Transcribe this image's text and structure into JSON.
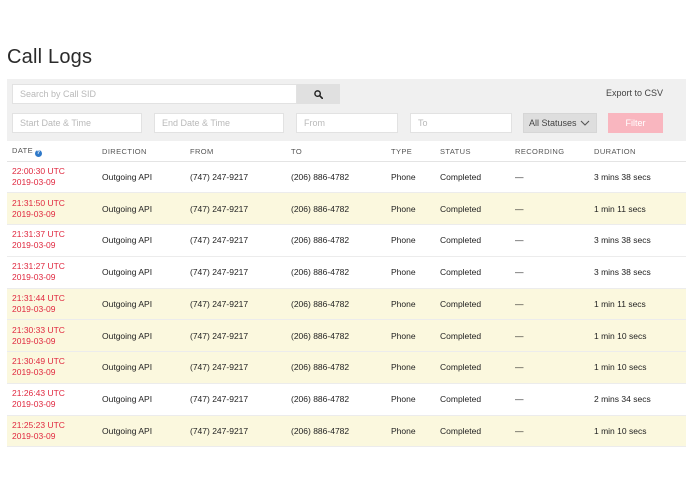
{
  "page": {
    "title": "Call Logs"
  },
  "search": {
    "placeholder": "Search by Call SID",
    "value": ""
  },
  "toolbar": {
    "export_label": "Export to CSV"
  },
  "filters": {
    "start_date_placeholder": "Start Date & Time",
    "end_date_placeholder": "End Date & Time",
    "from_placeholder": "From",
    "to_placeholder": "To",
    "status_selected": "All Statuses",
    "filter_label": "Filter"
  },
  "table": {
    "columns": {
      "date": "DATE",
      "direction": "DIRECTION",
      "from": "FROM",
      "to": "TO",
      "type": "TYPE",
      "status": "STATUS",
      "recording": "RECORDING",
      "duration": "DURATION"
    },
    "rows": [
      {
        "time": "22:00:30 UTC",
        "date": "2019-03-09",
        "direction": "Outgoing API",
        "from": "(747) 247-9217",
        "to": "(206) 886-4782",
        "type": "Phone",
        "status": "Completed",
        "recording": "—",
        "duration": "3 mins 38 secs",
        "highlighted": false
      },
      {
        "time": "21:31:50 UTC",
        "date": "2019-03-09",
        "direction": "Outgoing API",
        "from": "(747) 247-9217",
        "to": "(206) 886-4782",
        "type": "Phone",
        "status": "Completed",
        "recording": "—",
        "duration": "1 min 11 secs",
        "highlighted": true
      },
      {
        "time": "21:31:37 UTC",
        "date": "2019-03-09",
        "direction": "Outgoing API",
        "from": "(747) 247-9217",
        "to": "(206) 886-4782",
        "type": "Phone",
        "status": "Completed",
        "recording": "—",
        "duration": "3 mins 38 secs",
        "highlighted": false
      },
      {
        "time": "21:31:27 UTC",
        "date": "2019-03-09",
        "direction": "Outgoing API",
        "from": "(747) 247-9217",
        "to": "(206) 886-4782",
        "type": "Phone",
        "status": "Completed",
        "recording": "—",
        "duration": "3 mins 38 secs",
        "highlighted": false
      },
      {
        "time": "21:31:44 UTC",
        "date": "2019-03-09",
        "direction": "Outgoing API",
        "from": "(747) 247-9217",
        "to": "(206) 886-4782",
        "type": "Phone",
        "status": "Completed",
        "recording": "—",
        "duration": "1 min 11 secs",
        "highlighted": true
      },
      {
        "time": "21:30:33 UTC",
        "date": "2019-03-09",
        "direction": "Outgoing API",
        "from": "(747) 247-9217",
        "to": "(206) 886-4782",
        "type": "Phone",
        "status": "Completed",
        "recording": "—",
        "duration": "1 min 10 secs",
        "highlighted": true
      },
      {
        "time": "21:30:49 UTC",
        "date": "2019-03-09",
        "direction": "Outgoing API",
        "from": "(747) 247-9217",
        "to": "(206) 886-4782",
        "type": "Phone",
        "status": "Completed",
        "recording": "—",
        "duration": "1 min 10 secs",
        "highlighted": true
      },
      {
        "time": "21:26:43 UTC",
        "date": "2019-03-09",
        "direction": "Outgoing API",
        "from": "(747) 247-9217",
        "to": "(206) 886-4782",
        "type": "Phone",
        "status": "Completed",
        "recording": "—",
        "duration": "2 mins 34 secs",
        "highlighted": false
      },
      {
        "time": "21:25:23 UTC",
        "date": "2019-03-09",
        "direction": "Outgoing API",
        "from": "(747) 247-9217",
        "to": "(206) 886-4782",
        "type": "Phone",
        "status": "Completed",
        "recording": "—",
        "duration": "1 min 10 secs",
        "highlighted": true
      }
    ]
  },
  "colors": {
    "date_text": "#e0283f",
    "highlight_row": "#fbf8de",
    "filter_button": "#f9b6bf",
    "help_icon": "#2f79c9",
    "panel_background": "#f0f0f0"
  },
  "icons": {
    "search": "search-icon",
    "help": "help-icon",
    "dropdown": "chevron-down-icon"
  }
}
